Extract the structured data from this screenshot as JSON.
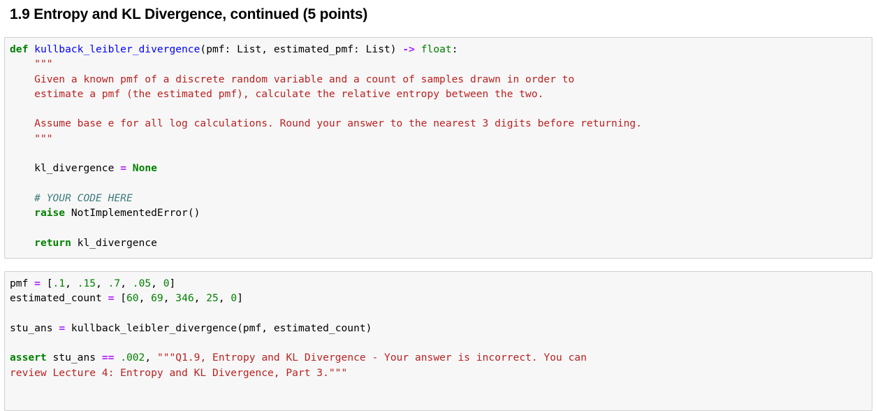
{
  "page": {
    "background": "#ffffff",
    "heading": "1.9 Entropy and KL Divergence, continued (5 points)"
  },
  "theme": {
    "cell_background": "#f7f7f7",
    "cell_border": "#cfcfcf",
    "keyword_color": "#008000",
    "function_color": "#0000ff",
    "operator_color": "#aa22ff",
    "string_color": "#ba2121",
    "comment_color": "#3d7b7b",
    "number_color": "#008000",
    "text_color": "#000000"
  },
  "cells": [
    {
      "name": "function-definition-cell",
      "lines": {
        "l1_def": "def",
        "l1_name": "kullback_leibler_divergence",
        "l1_open": "(",
        "l1_args": "pmf: List, estimated_pmf: List",
        "l1_close": ")",
        "l1_arrow": "->",
        "l1_rettype": "float",
        "l1_colon": ":",
        "l2_docquote_open": "\"\"\"",
        "l3_doc": "Given a known pmf of a discrete random variable and a count of samples drawn in order to",
        "l4_doc": "estimate a pmf (the estimated pmf), calculate the relative entropy between the two.",
        "l5_blank": "",
        "l6_doc": "Assume base e for all log calculations. Round your answer to the nearest 3 digits before returning.",
        "l7_docquote_close": "\"\"\"",
        "l8_var": "kl_divergence",
        "l8_eq": "=",
        "l8_none": "None",
        "l9_comment": "# YOUR CODE HERE",
        "l10_raise": "raise",
        "l10_error": "NotImplementedError()",
        "l11_return": "return",
        "l11_value": "kl_divergence"
      }
    },
    {
      "name": "test-assertion-cell",
      "lines": {
        "t1_var": "pmf",
        "t1_eq": "=",
        "t1_open": "[",
        "t1_v1": ".1",
        "t1_v2": ".15",
        "t1_v3": ".7",
        "t1_v4": ".05",
        "t1_v5": "0",
        "t1_close": "]",
        "t2_var": "estimated_count",
        "t2_eq": "=",
        "t2_open": "[",
        "t2_v1": "60",
        "t2_v2": "69",
        "t2_v3": "346",
        "t2_v4": "25",
        "t2_v5": "0",
        "t2_close": "]",
        "t3_var": "stu_ans",
        "t3_eq": "=",
        "t3_call": "kullback_leibler_divergence(pmf, estimated_count)",
        "t4_assert": "assert",
        "t4_var": "stu_ans",
        "t4_eqeq": "==",
        "t4_expected": ".002",
        "t4_comma": ",",
        "t4_message_line1": "\"\"\"Q1.9, Entropy and KL Divergence - Your answer is incorrect. You can",
        "t4_message_line2": "review Lecture 4: Entropy and KL Divergence, Part 3.\"\"\""
      }
    }
  ]
}
